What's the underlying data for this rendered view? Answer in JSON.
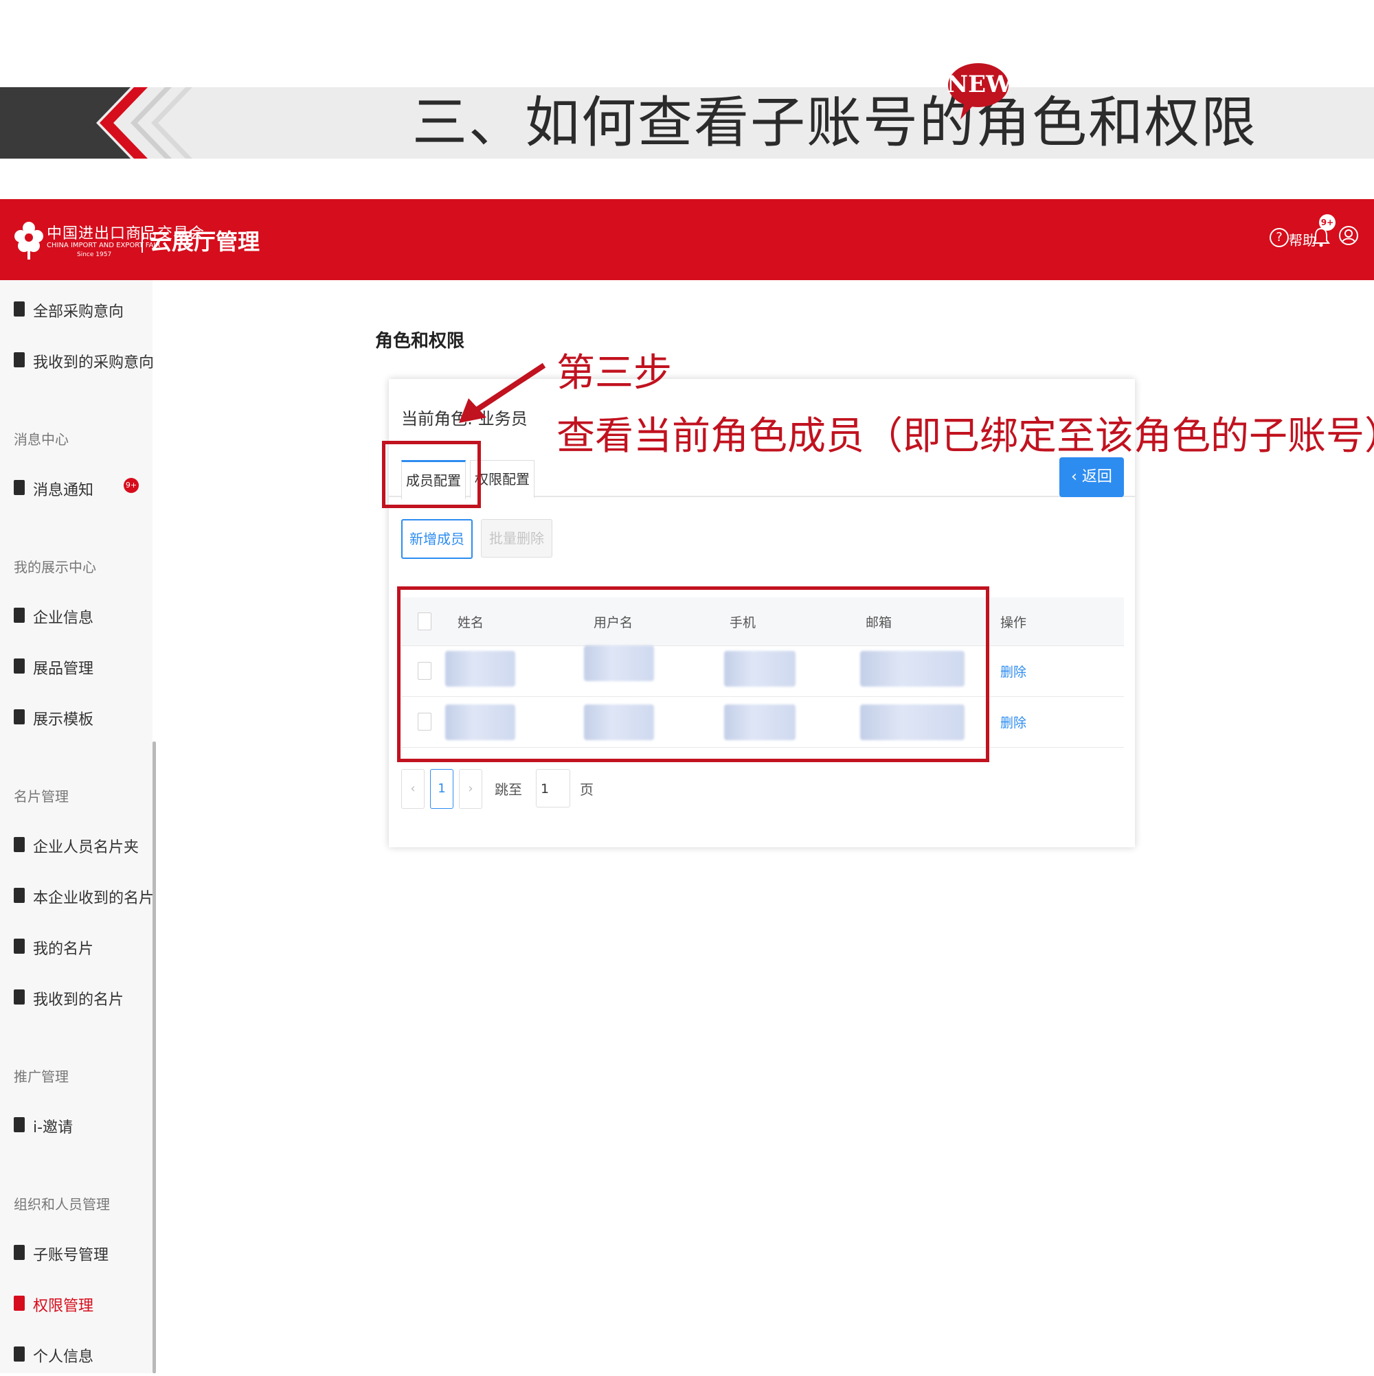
{
  "slide": {
    "title": "三、如何查看子账号的角色和权限",
    "badge": "NEW"
  },
  "header": {
    "logo_cn": "中国进出口商品交易会",
    "logo_en": "CHINA IMPORT AND EXPORT FAIR",
    "logo_since": "Since 1957",
    "app_title": "云展厅管理",
    "help_label": "帮助",
    "bell_badge": "9+",
    "brand_color": "#d60d1c"
  },
  "sidebar": {
    "items_top": [
      {
        "label": "全部采购意向",
        "icon": "document-icon"
      },
      {
        "label": "我收到的采购意向",
        "icon": "document-inbox-icon"
      }
    ],
    "sections": [
      {
        "heading": "消息中心",
        "items": [
          {
            "label": "消息通知",
            "icon": "bell-icon",
            "badge": "9+"
          }
        ]
      },
      {
        "heading": "我的展示中心",
        "items": [
          {
            "label": "企业信息",
            "icon": "org-icon"
          },
          {
            "label": "展品管理",
            "icon": "grid-icon"
          },
          {
            "label": "展示模板",
            "icon": "template-icon"
          }
        ]
      },
      {
        "heading": "名片管理",
        "items": [
          {
            "label": "企业人员名片夹",
            "icon": "card-holder-icon"
          },
          {
            "label": "本企业收到的名片",
            "icon": "card-received-icon"
          },
          {
            "label": "我的名片",
            "icon": "card-icon"
          },
          {
            "label": "我收到的名片",
            "icon": "card-inbox-icon"
          }
        ]
      },
      {
        "heading": "推广管理",
        "items": [
          {
            "label": "i-邀请",
            "icon": "invite-icon"
          }
        ]
      },
      {
        "heading": "组织和人员管理",
        "items": [
          {
            "label": "子账号管理",
            "icon": "subaccount-icon"
          },
          {
            "label": "权限管理",
            "icon": "lock-icon",
            "active": true
          },
          {
            "label": "个人信息",
            "icon": "profile-icon"
          }
        ]
      }
    ]
  },
  "main": {
    "page_title": "角色和权限",
    "role_prefix": "当前角色:",
    "role_value": "业务员",
    "tabs": [
      "成员配置",
      "权限配置"
    ],
    "back_button": "返回",
    "add_member": "新增成员",
    "batch_delete": "批量删除",
    "table": {
      "columns": [
        "姓名",
        "用户名",
        "手机",
        "邮箱",
        "操作"
      ],
      "rows": [
        {
          "action": "删除"
        },
        {
          "action": "删除"
        }
      ]
    },
    "pagination": {
      "current": "1",
      "jump_label": "跳至",
      "jump_value": "1",
      "page_suffix": "页"
    }
  },
  "annotation": {
    "step": "第三步",
    "description": "查看当前角色成员（即已绑定至该角色的子账号）",
    "color": "#c1121f"
  }
}
